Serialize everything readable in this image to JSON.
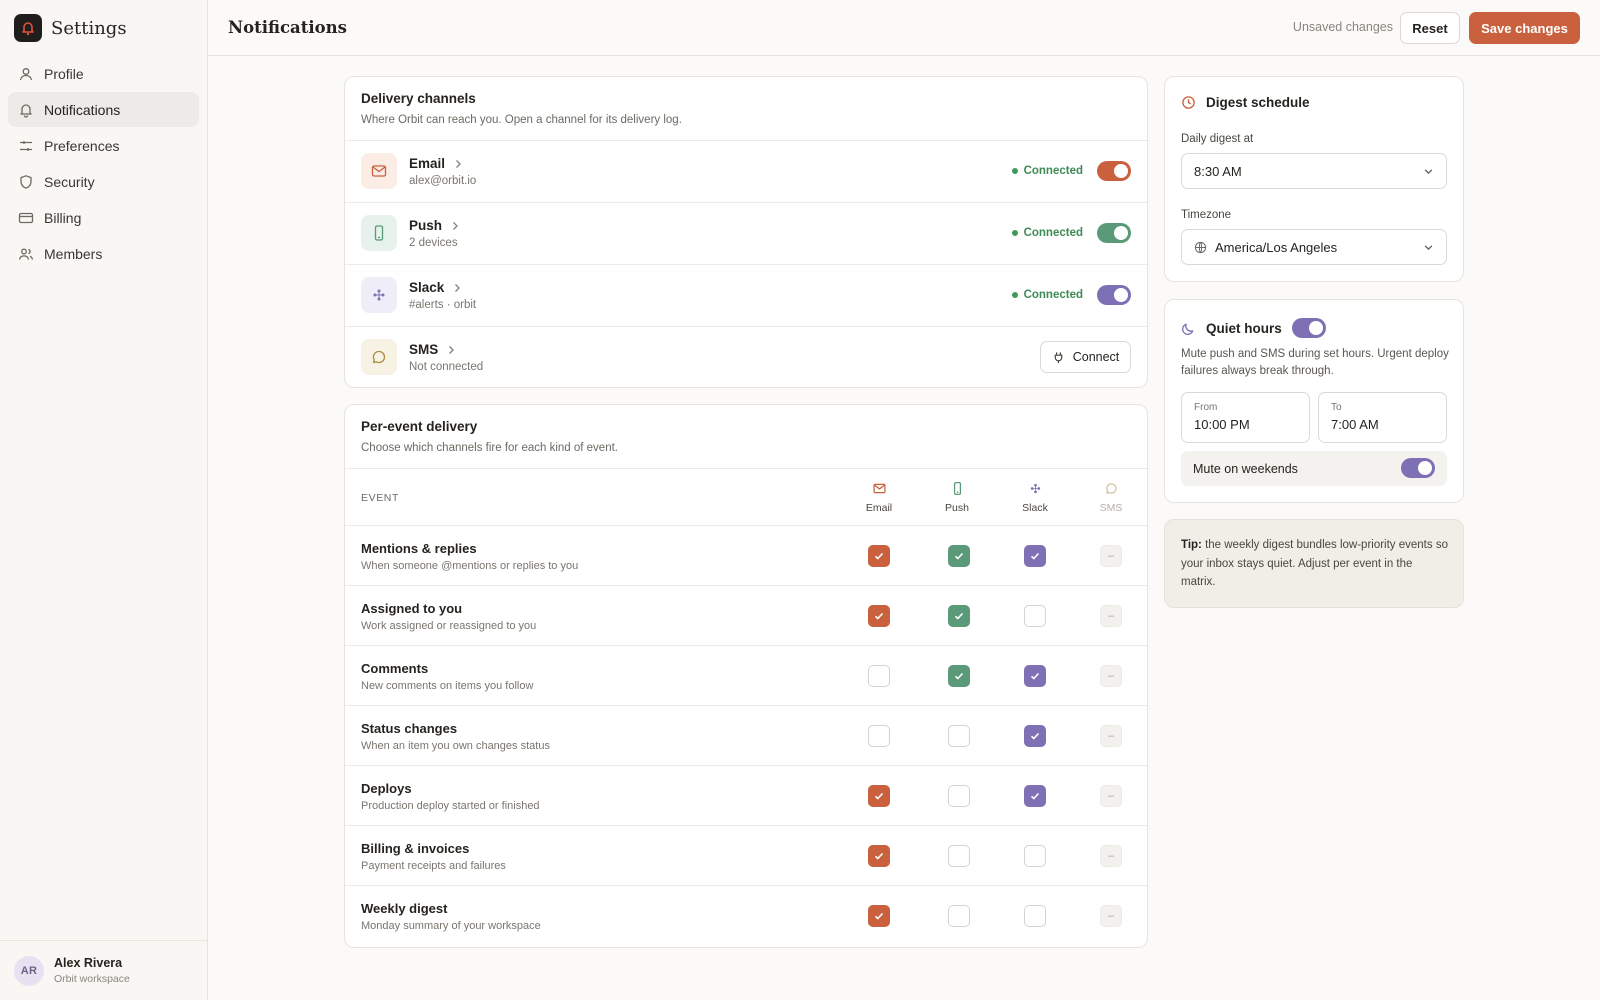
{
  "app": {
    "name": "Settings"
  },
  "colors": {
    "email": "#c9613f",
    "push": "#5a9a78",
    "slack": "#7d70b4",
    "sms": "#bfa052",
    "connected": "#3f8a55"
  },
  "sidebar": {
    "items": [
      {
        "label": "Profile",
        "icon": "user-icon",
        "active": false
      },
      {
        "label": "Notifications",
        "icon": "bell-icon",
        "active": true
      },
      {
        "label": "Preferences",
        "icon": "sliders-icon",
        "active": false
      },
      {
        "label": "Security",
        "icon": "shield-icon",
        "active": false
      },
      {
        "label": "Billing",
        "icon": "credit-card-icon",
        "active": false
      },
      {
        "label": "Members",
        "icon": "users-icon",
        "active": false
      }
    ],
    "user": {
      "initials": "AR",
      "name": "Alex Rivera",
      "workspace": "Orbit workspace"
    }
  },
  "topbar": {
    "title": "Notifications",
    "unsaved": "Unsaved changes",
    "reset_label": "Reset",
    "save_label": "Save changes"
  },
  "channels": {
    "title": "Delivery channels",
    "subtitle": "Where Orbit can reach you. Open a channel for its delivery log.",
    "items": [
      {
        "name": "Email",
        "detail": "alex@orbit.io",
        "status": "Connected",
        "enabled": true
      },
      {
        "name": "Push",
        "detail": "2 devices",
        "status": "Connected",
        "enabled": true
      },
      {
        "name": "Slack",
        "detail": "#alerts · orbit",
        "status": "Connected",
        "enabled": true
      },
      {
        "name": "SMS",
        "detail": "Not connected",
        "action": "Connect"
      }
    ]
  },
  "events": {
    "title": "Per-event delivery",
    "subtitle": "Choose which channels fire for each kind of event.",
    "column_event": "EVENT",
    "columns": [
      "Email",
      "Push",
      "Slack",
      "SMS"
    ],
    "disabled_mark": "–",
    "rows": [
      {
        "name": "Mentions & replies",
        "desc": "When someone @mentions or replies to you",
        "email": true,
        "push": true,
        "slack": true
      },
      {
        "name": "Assigned to you",
        "desc": "Work assigned or reassigned to you",
        "email": true,
        "push": true,
        "slack": false
      },
      {
        "name": "Comments",
        "desc": "New comments on items you follow",
        "email": false,
        "push": true,
        "slack": true
      },
      {
        "name": "Status changes",
        "desc": "When an item you own changes status",
        "email": false,
        "push": false,
        "slack": true
      },
      {
        "name": "Deploys",
        "desc": "Production deploy started or finished",
        "email": true,
        "push": false,
        "slack": true
      },
      {
        "name": "Billing & invoices",
        "desc": "Payment receipts and failures",
        "email": true,
        "push": false,
        "slack": false
      },
      {
        "name": "Weekly digest",
        "desc": "Monday summary of your workspace",
        "email": true,
        "push": false,
        "slack": false
      }
    ]
  },
  "digest": {
    "title": "Digest schedule",
    "daily_label": "Daily digest at",
    "daily_value": "8:30 AM",
    "tz_label": "Timezone",
    "tz_value": "America/Los Angeles"
  },
  "quiet": {
    "title": "Quiet hours",
    "enabled": true,
    "desc": "Mute push and SMS during set hours. Urgent deploy failures always break through.",
    "from_label": "From",
    "from_value": "10:00 PM",
    "to_label": "To",
    "to_value": "7:00 AM",
    "weekend_label": "Mute on weekends",
    "weekend_enabled": true
  },
  "tip": {
    "lead": "Tip:",
    "text": " the weekly digest bundles low-priority events so your inbox stays quiet. Adjust per event in the matrix."
  }
}
